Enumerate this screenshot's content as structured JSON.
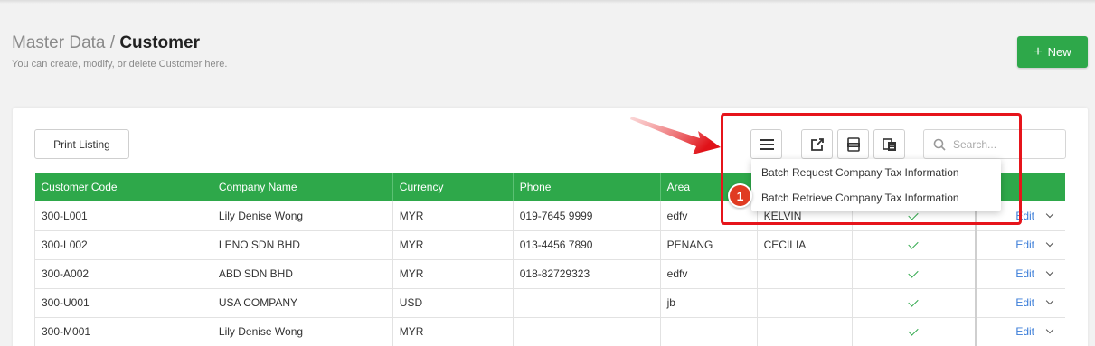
{
  "header": {
    "breadcrumb_parent": "Master Data",
    "breadcrumb_sep": "/",
    "title": "Customer",
    "subtitle": "You can create, modify, or delete Customer here.",
    "new_label": "New"
  },
  "toolbar": {
    "print_label": "Print Listing",
    "search_placeholder": "Search...",
    "icons": [
      "menu-icon",
      "export-icon",
      "csv-icon",
      "copy-document-icon",
      "search-icon"
    ]
  },
  "dropdown": {
    "items": [
      "Batch Request Company Tax Information",
      "Batch Retrieve Company Tax Information"
    ]
  },
  "annotation": {
    "badge": "1",
    "color": "#e6141b"
  },
  "colors": {
    "primary": "#2ea84a",
    "link": "#3b7dd8"
  },
  "table": {
    "columns": [
      "Customer Code",
      "Company Name",
      "Currency",
      "Phone",
      "Area",
      "",
      "",
      ""
    ],
    "rows": [
      {
        "code": "300-L001",
        "name": "Lily Denise Wong",
        "currency": "MYR",
        "phone": "019-7645 9999",
        "area": "edfv",
        "agent": "KELVIN",
        "active": true,
        "action": "Edit"
      },
      {
        "code": "300-L002",
        "name": "LENO SDN BHD",
        "currency": "MYR",
        "phone": "013-4456 7890",
        "area": "PENANG",
        "agent": "CECILIA",
        "active": true,
        "action": "Edit"
      },
      {
        "code": "300-A002",
        "name": "ABD SDN BHD",
        "currency": "MYR",
        "phone": "018-82729323",
        "area": "edfv",
        "agent": "",
        "active": true,
        "action": "Edit"
      },
      {
        "code": "300-U001",
        "name": "USA COMPANY",
        "currency": "USD",
        "phone": "",
        "area": "jb",
        "agent": "",
        "active": true,
        "action": "Edit"
      },
      {
        "code": "300-M001",
        "name": "Lily Denise Wong",
        "currency": "MYR",
        "phone": "",
        "area": "",
        "agent": "",
        "active": true,
        "action": "Edit"
      }
    ]
  }
}
